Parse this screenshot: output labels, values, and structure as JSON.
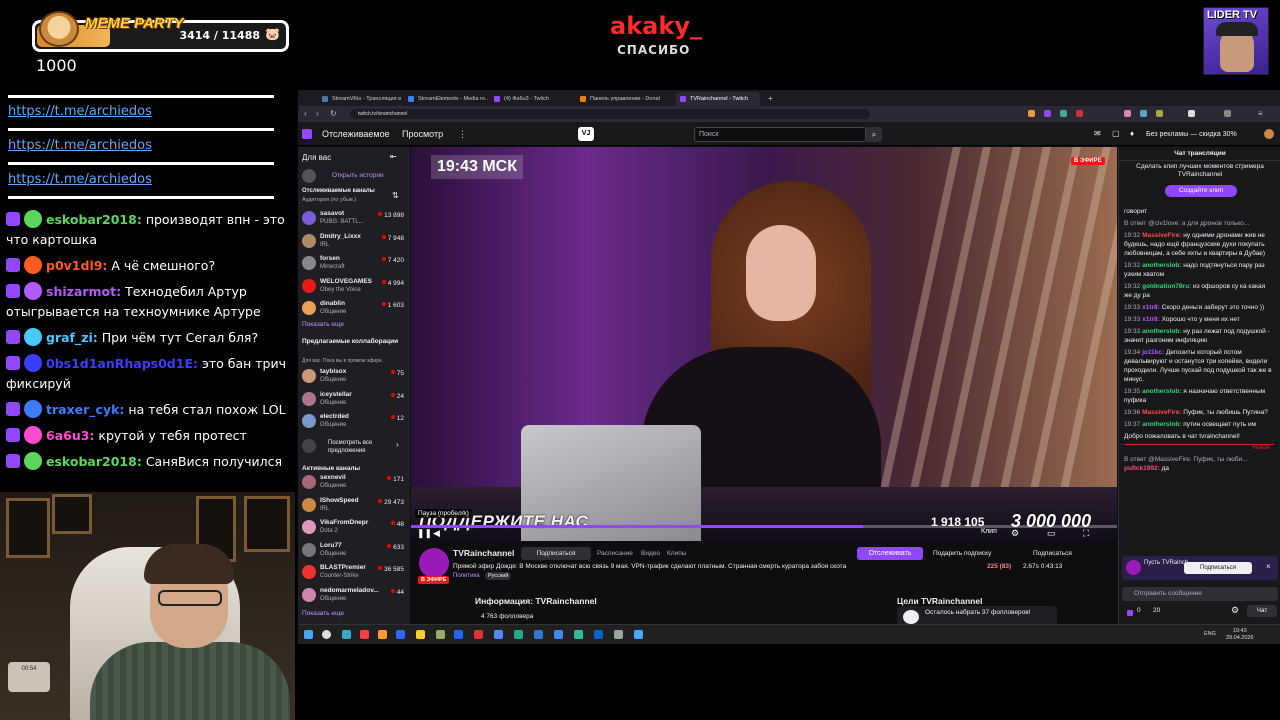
{
  "overlay": {
    "goal": {
      "label": "MEME PARTY",
      "count": "3414 / 11488",
      "pig_icon": "🐷",
      "progress_fraction": 0.297,
      "sub_text": "1000"
    },
    "telegram_links": [
      "https://t.me/archiedos",
      "https://t.me/archiedos",
      "https://t.me/archiedos"
    ],
    "chat": [
      {
        "name": "eskobar2018:",
        "name_color": "#5bd75b",
        "text": "производят впн - это что картошка"
      },
      {
        "name": "p0v1dl9:",
        "name_color": "#ff5a1f",
        "text": "А чё смешного?"
      },
      {
        "name": "shizarmot:",
        "name_color": "#b15bff",
        "text": "Технодебил Артур отыгрывается на техноумнике Артуре"
      },
      {
        "name": "graf_zi:",
        "name_color": "#47c8ff",
        "text": "При чём тут Сегал бля?"
      },
      {
        "name": "0bs1d1anRhaps0d1E:",
        "name_color": "#3d3dff",
        "text": "это бан трич фиксируй"
      },
      {
        "name": "traxer_cyk:",
        "name_color": "#3d7bff",
        "text": "на тебя стал похож LOL"
      },
      {
        "name": "6a6u3:",
        "name_color": "#ff4bd1",
        "text": "крутой у тебя протест"
      },
      {
        "name": "eskobar2018:",
        "name_color": "#5bd75b",
        "text": "СаняВися получился"
      }
    ],
    "webcam_device_label": "00:54"
  },
  "alert": {
    "name": "akaky_",
    "sub": "СПАСИБО"
  },
  "lider": {
    "label": "LIDER TV"
  },
  "browser": {
    "tabs": [
      {
        "label": "StreamVKio - Трансляция в не...",
        "color": "#4a76a8"
      },
      {
        "label": "StreamElements - Media re...",
        "color": "#3b82f6"
      },
      {
        "label": "(4) Фа6u3 - Twitch",
        "color": "#9146ff"
      },
      {
        "label": "Панель управления - Donatio...",
        "color": "#f57c00"
      },
      {
        "label": "TVRainchannel - Twitch",
        "color": "#9146ff"
      }
    ],
    "address": "twitch.tv/tvrainchannel"
  },
  "twitch": {
    "nav": {
      "following": "Отслеживаемое",
      "browse": "Просмотр",
      "more": "⋮",
      "vj": "VJ",
      "search_placeholder": "Поиск",
      "search_icon": "⌕",
      "turbo": "Без рекламы — скидка 30%"
    },
    "sidebar": {
      "for_you": "Для вас",
      "collapse": "⇤",
      "history": "Открыть истории",
      "followed_head": "Отслеживаемые каналы",
      "followed_sub": "Аудитория (по убыв.)",
      "sort_icon": "⇅",
      "followed": [
        {
          "name": "sasavot",
          "cat": "PUBG: BATTL...",
          "viewers": "13 898",
          "color": "#7b5bd6"
        },
        {
          "name": "Dmitry_Lixxx",
          "cat": "IRL",
          "viewers": "7 948",
          "color": "#b08968"
        },
        {
          "name": "forsen",
          "cat": "Minecraft",
          "viewers": "7 420",
          "color": "#888"
        },
        {
          "name": "WELOVEGAMES",
          "cat": "Obey the Voice",
          "viewers": "4 994",
          "color": "#e91916"
        },
        {
          "name": "dinablin",
          "cat": "Общение",
          "viewers": "1 603",
          "color": "#e6a05a"
        }
      ],
      "show_more": "Показать еще",
      "suggested_head": "Предлагаемые коллаборации",
      "suggested_sub": "Для вас. Пока вы в прямом эфире.",
      "suggested": [
        {
          "name": "taybisox",
          "cat": "Общение",
          "viewers": "75",
          "color": "#c97"
        },
        {
          "name": "iceystellar",
          "cat": "Общение",
          "viewers": "24",
          "color": "#a78"
        },
        {
          "name": "electrded",
          "cat": "Общение",
          "viewers": "12",
          "color": "#79c"
        }
      ],
      "see_all": "Посмотреть все предложения",
      "active_head": "Активные каналы",
      "active": [
        {
          "name": "sexnevil",
          "cat": "Общение",
          "viewers": "171",
          "color": "#a67"
        },
        {
          "name": "IShowSpeed",
          "cat": "IRL",
          "viewers": "29 473",
          "color": "#c84"
        },
        {
          "name": "VikaFromDnepr",
          "cat": "Dota 2",
          "viewers": "48",
          "color": "#d9b"
        },
        {
          "name": "Loru77",
          "cat": "Общение",
          "viewers": "633",
          "color": "#777"
        },
        {
          "name": "BLASTPremier",
          "cat": "Counter-Strike",
          "viewers": "36 585",
          "color": "#e33"
        },
        {
          "name": "nedomarmeladov...",
          "cat": "Общение",
          "viewers": "44",
          "color": "#c8a"
        }
      ],
      "show_more_2": "Показать еще"
    },
    "player": {
      "clock": "19:43 МСК",
      "live": "В ЭФИРЕ",
      "banner": "ПОДДЕРЖИТЕ НАС",
      "num1": "1 918 105",
      "num2": "3 000 000",
      "progress_fraction": 0.64,
      "pause_tip": "Пауза (пробел/k)",
      "clip": "Клип"
    },
    "channel": {
      "name": "TVRainchannel",
      "live": "В ЭФИРЕ",
      "subscribe": "Подписаться",
      "schedule": "Расписание",
      "videos": "Видео",
      "clips": "Клипы",
      "follow": "Отслеживать",
      "gift": "Подарить подписку",
      "sub2": "Подписаться",
      "title": "Прямой эфир Дождя: В Москве отключат всю связь 9 мая. VPN-трафик сделают платным. Странная смерть куратора забоя скота",
      "category": "Политика",
      "lang": "Русский",
      "viewers": "225 (83)",
      "stats": "2.67s  0:43:13",
      "about": "Информация: TVRainchannel",
      "followers": "4 763 фолловера",
      "goals_head": "Цели TVRainchannel",
      "goal_text": "Осталось набрать 37 фолловеров!"
    },
    "chat": {
      "header": "Чат трансляции",
      "promo": "Сделать клип лучших моментов стримера TVRainchannel",
      "clip_btn": "Создайте клип",
      "messages": [
        {
          "time": "",
          "user": "",
          "color": "#efeff1",
          "reply": "",
          "text": "говорит"
        },
        {
          "time": "",
          "user": "",
          "color": "#efeff1",
          "reply": "В ответ @civ1love: а для дронов только...",
          "text": ""
        },
        {
          "time": "19:32",
          "user": "MassiveFire:",
          "color": "#ff4b4b",
          "reply": "",
          "text": "ну одними дронами жив не будешь, надо ещё французские духи покупать любовницам, а себе яхты и квартиры в Дубае)"
        },
        {
          "time": "19:32",
          "user": "anotherslob:",
          "color": "#2ed573",
          "reply": "",
          "text": "надо подтянуться пару раз узким хватом"
        },
        {
          "time": "19:32",
          "user": "goldnation78ru:",
          "color": "#2ed573",
          "reply": "",
          "text": "из офшоров су ка какая же ду ра"
        },
        {
          "time": "19:33",
          "user": "x1tr8:",
          "color": "#b15bff",
          "reply": "",
          "text": "Скоро деньги заберут это точно ))"
        },
        {
          "time": "19:33",
          "user": "x1tr8:",
          "color": "#b15bff",
          "reply": "",
          "text": "Хорошо что у меня их нет"
        },
        {
          "time": "19:33",
          "user": "anotherslob:",
          "color": "#2ed573",
          "reply": "",
          "text": "ну раз лежат под подушкой - значит разгоним инфляцию"
        },
        {
          "time": "19:34",
          "user": "jo11kc:",
          "color": "#b15bff",
          "reply": "",
          "text": "Депозиты который потом девальвируют и останутся три копейки, видели проходили. Лучше пускай под подушкой так же в минус."
        },
        {
          "time": "19:35",
          "user": "anotherslob:",
          "color": "#2ed573",
          "reply": "",
          "text": "я назначаю ответственным пуфика"
        },
        {
          "time": "19:36",
          "user": "MassiveFire:",
          "color": "#ff4b4b",
          "reply": "",
          "text": "Пуфик, ты любишь Путина?"
        },
        {
          "time": "19:37",
          "user": "anotherslob:",
          "color": "#2ed573",
          "reply": "",
          "text": "путин освещает путь им"
        },
        {
          "time": "",
          "user": "",
          "color": "#efeff1",
          "reply": "",
          "text": "Добро пожаловать в чат tvrainchannel!"
        }
      ],
      "new_label": "Новое",
      "reply_last": "В ответ @MassiveFire: Пуфик, ты люби...",
      "last_user": "pufick1992:",
      "last_text": "да",
      "pin_text": "Пусть TVRainch...",
      "pin_sub": "Подписаться",
      "input_placeholder": "Отправить сообщение",
      "points": "0",
      "points2": "20",
      "send": "Чат"
    },
    "taskbar": {
      "lang": "ENG",
      "time": "19:43",
      "date": "29.04.2026"
    }
  }
}
